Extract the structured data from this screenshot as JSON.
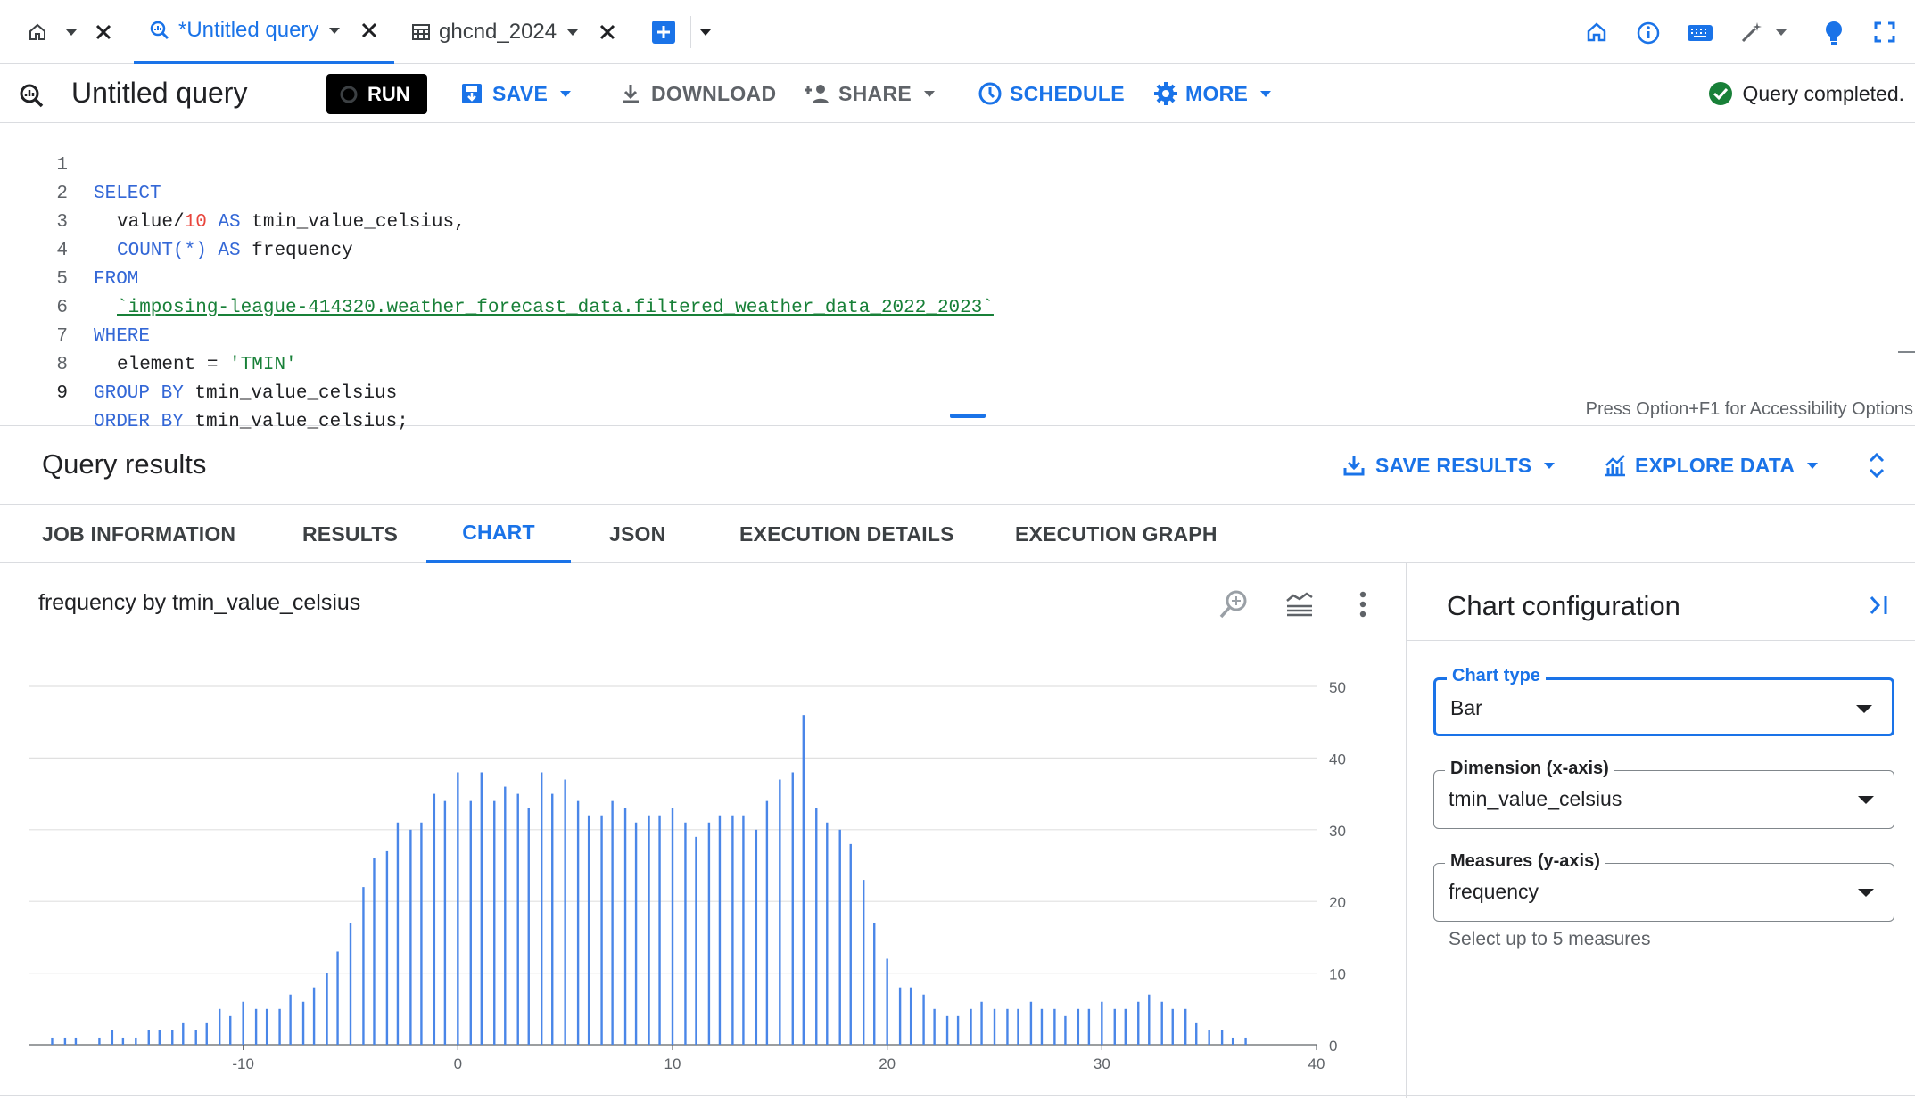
{
  "tabbar": {
    "tabs": [
      {
        "label": "*Untitled query",
        "active": true
      },
      {
        "label": "ghcnd_2024",
        "active": false
      }
    ]
  },
  "toolbar": {
    "title": "Untitled query",
    "run_label": "RUN",
    "save_label": "SAVE",
    "download_label": "DOWNLOAD",
    "share_label": "SHARE",
    "schedule_label": "SCHEDULE",
    "more_label": "MORE",
    "status": "Query completed."
  },
  "editor": {
    "accessibility_hint": "Press Option+F1 for Accessibility Options",
    "line_numbers": [
      "1",
      "2",
      "3",
      "4",
      "5",
      "6",
      "7",
      "8",
      "9"
    ],
    "tokens": {
      "l1_kw": "SELECT",
      "l2_a": "value/",
      "l2_num": "10",
      "l2_kw": " AS ",
      "l2_b": "tmin_value_celsius,",
      "l3_kw1": "COUNT(*)",
      "l3_kw2": " AS ",
      "l3_b": "frequency",
      "l4_kw": "FROM",
      "l5_tbl": "`imposing-league-414320.weather_forecast_data.filtered_weather_data_2022_2023`",
      "l6_kw": "WHERE",
      "l7_a": "element = ",
      "l7_str": "'TMIN'",
      "l8_kw": "GROUP BY ",
      "l8_b": "tmin_value_celsius",
      "l9_kw": "ORDER BY ",
      "l9_b": "tmin_value_celsius;"
    }
  },
  "results": {
    "title": "Query results",
    "save_results_label": "SAVE RESULTS",
    "explore_data_label": "EXPLORE DATA",
    "tabs": [
      {
        "label": "JOB INFORMATION",
        "active": false
      },
      {
        "label": "RESULTS",
        "active": false
      },
      {
        "label": "CHART",
        "active": true
      },
      {
        "label": "JSON",
        "active": false
      },
      {
        "label": "EXECUTION DETAILS",
        "active": false
      },
      {
        "label": "EXECUTION GRAPH",
        "active": false
      }
    ]
  },
  "config": {
    "title": "Chart configuration",
    "chart_type_label": "Chart type",
    "chart_type_value": "Bar",
    "dimension_label": "Dimension (x-axis)",
    "dimension_value": "tmin_value_celsius",
    "measures_label": "Measures (y-axis)",
    "measures_value": "frequency",
    "measures_hint": "Select up to 5 measures"
  },
  "chart_data": {
    "type": "bar",
    "title": "frequency by tmin_value_celsius",
    "xlabel": "",
    "ylabel": "",
    "xlim": [
      -20,
      40
    ],
    "ylim": [
      0,
      50
    ],
    "xticks": [
      -10,
      0,
      10,
      20,
      30,
      40
    ],
    "yticks": [
      0,
      10,
      20,
      30,
      40,
      50
    ],
    "grid": true,
    "color": "#4a86e8",
    "series": [
      {
        "x": [
          -18.9,
          -18.3,
          -17.8,
          -16.7,
          -16.1,
          -15.6,
          -15.0,
          -14.4,
          -13.9,
          -13.3,
          -12.8,
          -12.2,
          -11.7,
          -11.1,
          -10.6,
          -10.0,
          -9.4,
          -8.9,
          -8.3,
          -7.8,
          -7.2,
          -6.7,
          -6.1,
          -5.6,
          -5.0,
          -4.4,
          -3.9,
          -3.3,
          -2.8,
          -2.2,
          -1.7,
          -1.1,
          -0.6,
          0.0,
          0.6,
          1.1,
          1.7,
          2.2,
          2.8,
          3.3,
          3.9,
          4.4,
          5.0,
          5.6,
          6.1,
          6.7,
          7.2,
          7.8,
          8.3,
          8.9,
          9.4,
          10.0,
          10.6,
          11.1,
          11.7,
          12.2,
          12.8,
          13.3,
          13.9,
          14.4,
          15.0,
          15.6,
          16.1,
          16.7,
          17.2,
          17.8,
          18.3,
          18.9,
          19.4,
          20.0,
          20.6,
          21.1,
          21.7,
          22.2,
          22.8,
          23.3,
          23.9,
          24.4,
          25.0,
          25.6,
          26.1,
          26.7,
          27.2,
          27.8,
          28.3,
          28.9,
          29.4,
          30.0,
          30.6,
          31.1,
          31.7,
          32.2,
          32.8,
          33.3,
          33.9,
          34.4,
          35.0,
          35.6,
          36.1,
          36.7
        ],
        "values": [
          1,
          1,
          1,
          1,
          2,
          1,
          1,
          2,
          2,
          2,
          3,
          2,
          3,
          5,
          4,
          6,
          5,
          5,
          5,
          7,
          6,
          8,
          10,
          13,
          17,
          22,
          26,
          27,
          31,
          30,
          31,
          35,
          34,
          38,
          34,
          38,
          34,
          36,
          35,
          33,
          38,
          35,
          37,
          34,
          32,
          32,
          34,
          33,
          31,
          32,
          32,
          33,
          31,
          29,
          31,
          32,
          32,
          32,
          30,
          34,
          37,
          38,
          46,
          33,
          31,
          30,
          28,
          23,
          17,
          12,
          8,
          8,
          7,
          5,
          4,
          4,
          5,
          6,
          5,
          5,
          5,
          6,
          5,
          5,
          4,
          5,
          5,
          6,
          5,
          5,
          6,
          7,
          6,
          5,
          5,
          3,
          2,
          2,
          1,
          1
        ]
      }
    ]
  }
}
